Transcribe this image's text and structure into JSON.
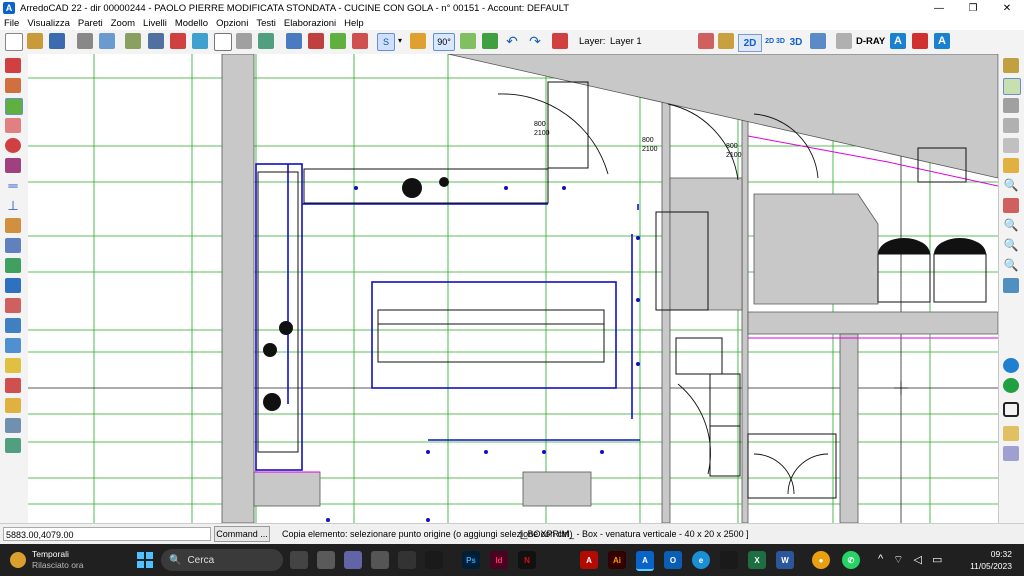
{
  "window": {
    "title": "ArredoCAD 22 - dir 00000244 - PAOLO PIERRE MODIFICATA STONDATA - CUCINE CON GOLA - n° 00151 - Account: DEFAULT",
    "app_icon_letter": "A",
    "minimize_glyph": "—",
    "maximize_glyph": "❐",
    "close_glyph": "✕"
  },
  "menu": [
    "File",
    "Visualizza",
    "Pareti",
    "Zoom",
    "Livelli",
    "Modello",
    "Opzioni",
    "Testi",
    "Elaborazioni",
    "Help"
  ],
  "toolbar": {
    "snap_label": "S",
    "angle_label": "90°",
    "layer_caption": "Layer:",
    "layer_value": "Layer 1",
    "mode_2d": "2D",
    "mode_2d3d": "2D 3D",
    "mode_3d": "3D",
    "dray_label": "D-RAY"
  },
  "drawing": {
    "door_label_1_width": "800",
    "door_label_1_height": "2100",
    "door_label_2_width": "800",
    "door_label_2_height": "2100",
    "door_label_3_width": "800",
    "door_label_3_height": "2100",
    "colors": {
      "wall": "#c8c8c8",
      "grid": "#22aa22",
      "cabinet": "#1010c0",
      "outline": "#000000",
      "magenta": "#e000e0"
    }
  },
  "status": {
    "coordinates": "5883.00,4079.00",
    "command_button": "Command ...",
    "message": "Copia elemento: selezionare punto origine (o aggiungi selezione con ctrl)",
    "primitive": "[_BOXPRIM_ - Box - venatura verticale - 40 x 20 x 2500 ]"
  },
  "taskbar": {
    "weather_title": "Temporali",
    "weather_subtitle": "Rilasciato ora",
    "search_placeholder": "Cerca",
    "time": "09:32",
    "date": "11/05/2023",
    "apps": [
      {
        "name": "Photoshop",
        "label": "Ps",
        "color": "#001e36"
      },
      {
        "name": "InDesign",
        "label": "Id",
        "color": "#49021f"
      },
      {
        "name": "Netflix",
        "label": "N",
        "color": "#111111"
      },
      {
        "name": "Acrobat",
        "label": "A",
        "color": "#b30b00"
      },
      {
        "name": "Illustrator",
        "label": "Ai",
        "color": "#330000"
      },
      {
        "name": "ArredoCAD",
        "label": "A",
        "color": "#0a64c8"
      },
      {
        "name": "Outlook",
        "label": "O",
        "color": "#0a5fb4"
      },
      {
        "name": "Edge",
        "label": "e",
        "color": "#1b8fd6"
      },
      {
        "name": "Excel",
        "label": "X",
        "color": "#1d6f42"
      },
      {
        "name": "Word",
        "label": "W",
        "color": "#2b579a"
      },
      {
        "name": "Chrome",
        "label": "●",
        "color": "#e8a010"
      },
      {
        "name": "WhatsApp",
        "label": "✆",
        "color": "#25d366"
      }
    ]
  }
}
